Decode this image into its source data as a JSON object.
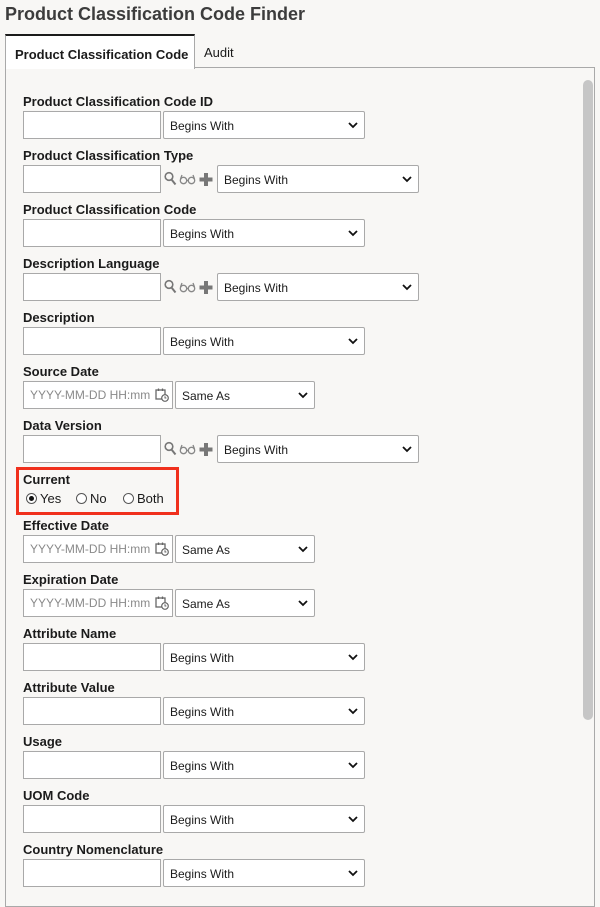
{
  "page": {
    "title": "Product Classification Code Finder"
  },
  "tabs": [
    {
      "label": "Product Classification Code"
    },
    {
      "label": "Audit"
    }
  ],
  "fields": [
    {
      "label": "Product Classification Code ID",
      "operator": "Begins With"
    },
    {
      "label": "Product Classification Type",
      "operator": "Begins With"
    },
    {
      "label": "Product Classification Code",
      "operator": "Begins With"
    },
    {
      "label": "Description Language",
      "operator": "Begins With"
    },
    {
      "label": "Description",
      "operator": "Begins With"
    },
    {
      "label": "Source Date",
      "placeholder": "YYYY-MM-DD HH:mm",
      "operator": "Same As"
    },
    {
      "label": "Data Version",
      "operator": "Begins With"
    },
    {
      "label": "Current",
      "options": [
        "Yes",
        "No",
        "Both"
      ],
      "selected": "Yes"
    },
    {
      "label": "Effective Date",
      "placeholder": "YYYY-MM-DD HH:mm",
      "operator": "Same As"
    },
    {
      "label": "Expiration Date",
      "placeholder": "YYYY-MM-DD HH:mm",
      "operator": "Same As"
    },
    {
      "label": "Attribute Name",
      "operator": "Begins With"
    },
    {
      "label": "Attribute Value",
      "operator": "Begins With"
    },
    {
      "label": "Usage",
      "operator": "Begins With"
    },
    {
      "label": "UOM Code",
      "operator": "Begins With"
    },
    {
      "label": "Country Nomenclature",
      "operator": "Begins With"
    }
  ],
  "icons": {
    "lookup": "search-icon",
    "view": "glasses-icon",
    "add": "plus-icon",
    "calendar": "calendar-clock-icon",
    "dropdown": "chevron-down-icon"
  },
  "colors": {
    "highlight": "#f0301d",
    "active_tab_border": "#1b1b1b"
  }
}
